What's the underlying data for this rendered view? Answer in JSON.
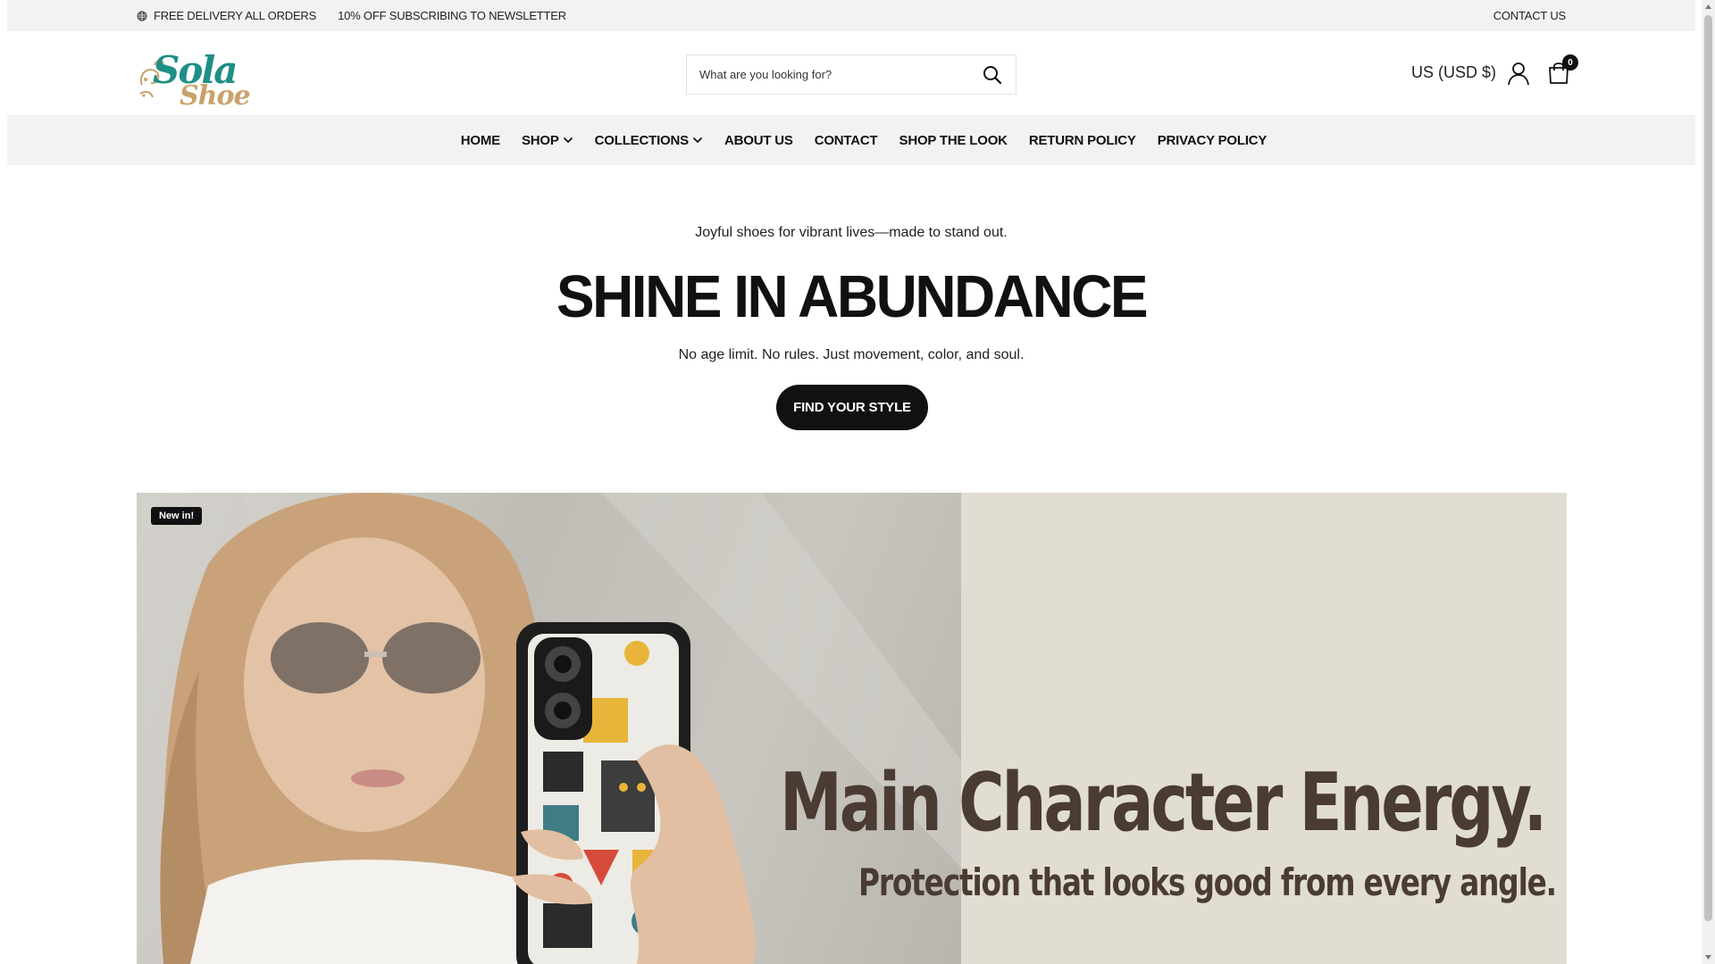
{
  "announcement": {
    "free_delivery": "FREE DELIVERY ALL ORDERS",
    "newsletter": "10% OFF SUBSCRIBING TO NEWSLETTER",
    "contact": "CONTACT US"
  },
  "header": {
    "logo_alt": "Sola Shoe",
    "search_placeholder": "What are you looking for?",
    "currency": "US (USD $)",
    "cart_count": "0"
  },
  "nav": {
    "items": [
      {
        "label": "HOME",
        "has_dropdown": false
      },
      {
        "label": "SHOP",
        "has_dropdown": true
      },
      {
        "label": "COLLECTIONS",
        "has_dropdown": true
      },
      {
        "label": "ABOUT US",
        "has_dropdown": false
      },
      {
        "label": "CONTACT",
        "has_dropdown": false
      },
      {
        "label": "SHOP THE LOOK",
        "has_dropdown": false
      },
      {
        "label": "RETURN POLICY",
        "has_dropdown": false
      },
      {
        "label": "PRIVACY POLICY",
        "has_dropdown": false
      }
    ]
  },
  "hero": {
    "tagline": "Joyful shoes for vibrant lives—made to stand out.",
    "headline": "SHINE IN ABUNDANCE",
    "subheadline": "No age limit. No rules. Just movement, color, and soul.",
    "cta": "FIND YOUR STYLE"
  },
  "banner": {
    "badge": "New in!",
    "title": "Main Character Energy.",
    "subtitle": "Protection that looks good from every angle."
  },
  "colors": {
    "logo_teal": "#1f8f86",
    "logo_gold": "#c9a26a",
    "banner_bg": "#e1ddd3",
    "banner_text": "#4a3b33",
    "nav_bg": "#f2f2f2"
  },
  "icons": {
    "topbar": "globe-icon",
    "search": "search-icon",
    "account": "user-icon",
    "cart": "shopping-bag-icon",
    "dropdown": "chevron-down-icon"
  }
}
